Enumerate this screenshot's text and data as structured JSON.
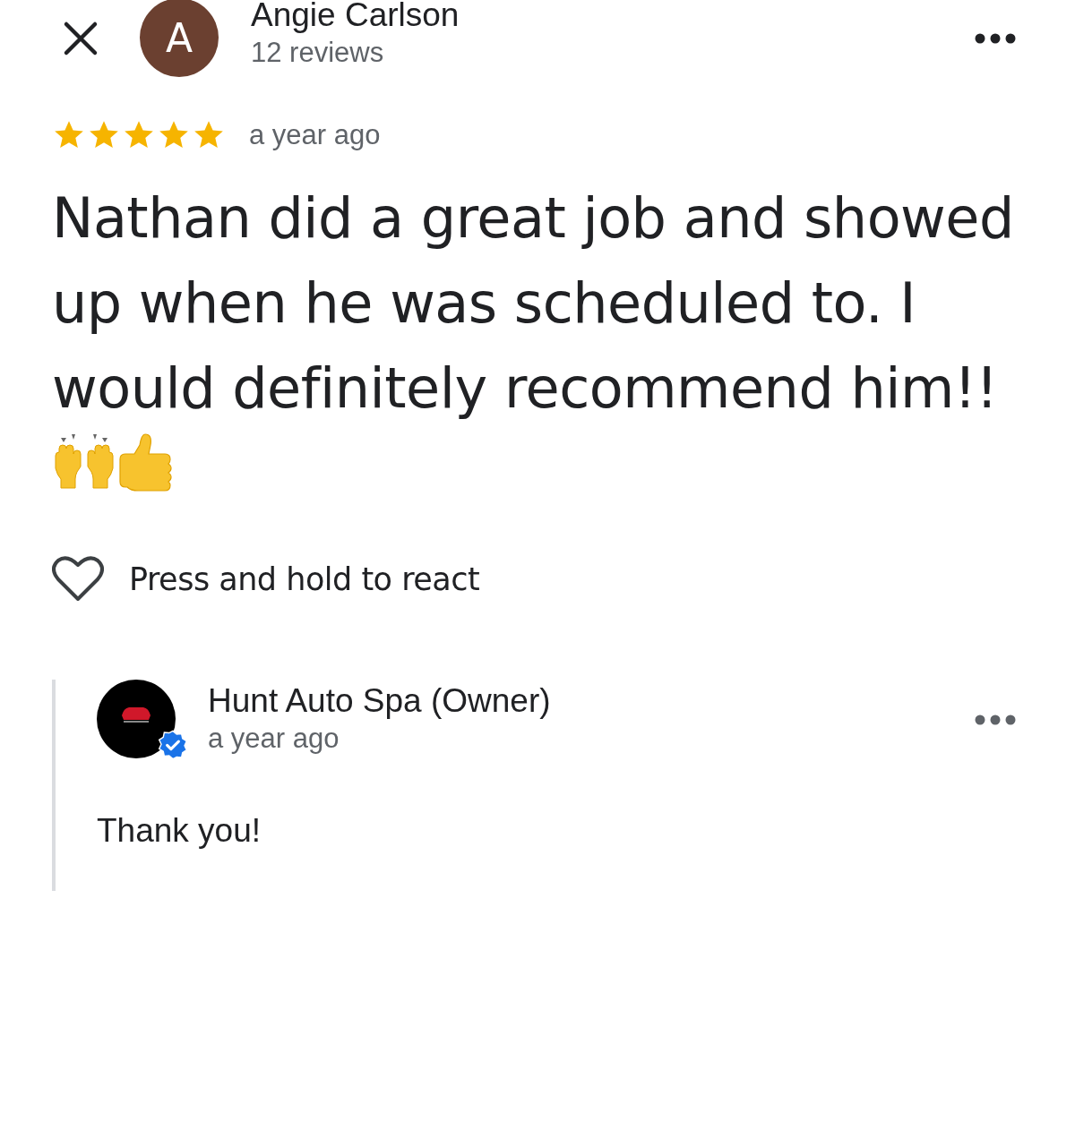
{
  "reviewer": {
    "initial": "A",
    "name": "Angie Carlson",
    "reviews": "12 reviews"
  },
  "review": {
    "stars": 5,
    "time": "a year ago",
    "text": "Nathan did a great job and showed up when he was scheduled to. I would definitely recommend him!!"
  },
  "react": {
    "label": "Press and hold to react",
    "liked": false
  },
  "owner_reply": {
    "name": "Hunt Auto Spa (Owner)",
    "time": "a year ago",
    "verified": true,
    "text": "Thank you!"
  }
}
